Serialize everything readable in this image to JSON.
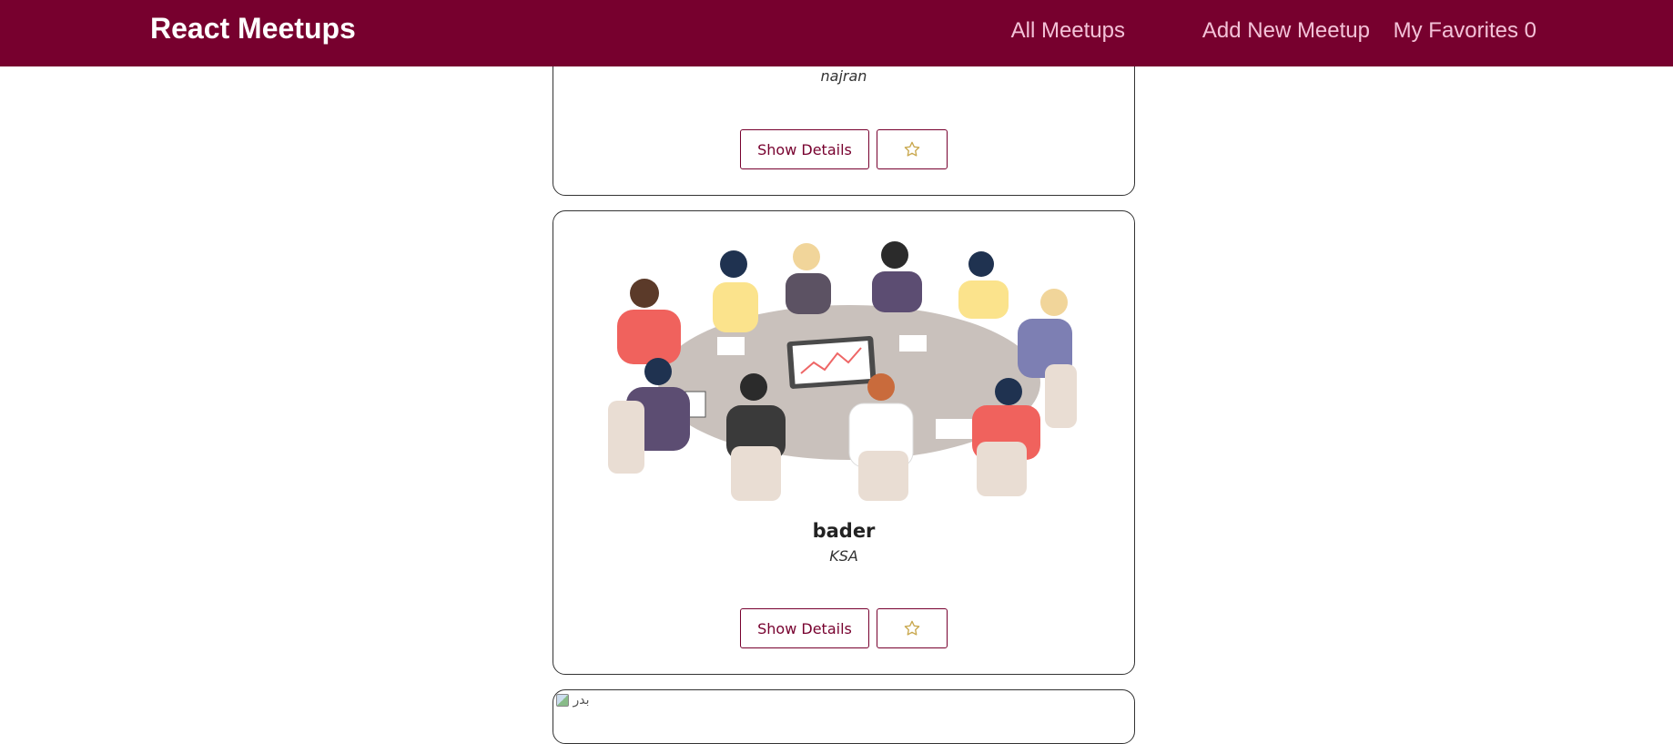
{
  "navbar": {
    "brand": "React Meetups",
    "links": [
      {
        "label": "All Meetups"
      },
      {
        "label": "Add New Meetup"
      },
      {
        "label": "My Favorites 0"
      }
    ]
  },
  "meetups": [
    {
      "address": "najran",
      "details_label": "Show Details",
      "favorite_icon": "star-outline-icon"
    },
    {
      "title": "bader",
      "address": "KSA",
      "image": "meeting-illustration",
      "details_label": "Show Details",
      "favorite_icon": "star-outline-icon"
    },
    {
      "image_alt": "بدر"
    }
  ],
  "colors": {
    "brand": "#77002e",
    "nav_link": "#f3c2d8",
    "star": "#c8a74c"
  }
}
